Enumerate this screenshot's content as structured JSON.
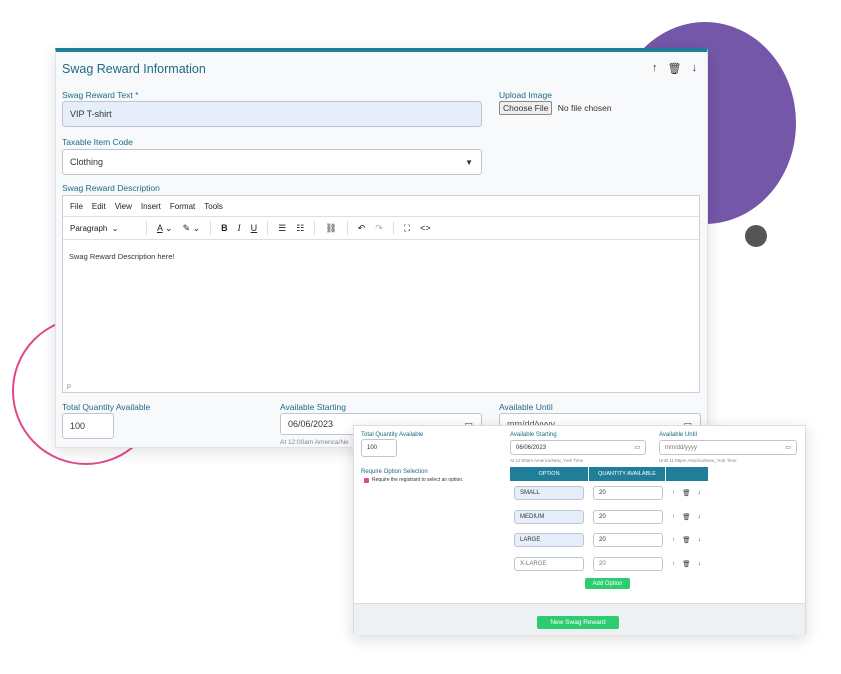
{
  "main": {
    "title": "Swag Reward Information",
    "header_icons": [
      "arrow-up-icon",
      "trash-icon",
      "arrow-down-icon"
    ],
    "reward_text_label": "Swag Reward Text *",
    "reward_text_value": "VIP T-shirt",
    "upload_label": "Upload Image",
    "choose_file": "Choose File",
    "no_file": "No file chosen",
    "taxable_label": "Taxable Item Code",
    "taxable_value": "Clothing",
    "desc_label": "Swag Reward Description",
    "menu": [
      "File",
      "Edit",
      "View",
      "Insert",
      "Format",
      "Tools"
    ],
    "paragraph": "Paragraph",
    "desc_body": "Swag Reward Description here!",
    "status_p": "P",
    "total_qty_label": "Total Quantity Available",
    "total_qty_value": "100",
    "avail_start_label": "Available Starting",
    "avail_start_value": "06/06/2023",
    "avail_start_note": "At 12:00am America/Ne",
    "avail_until_label": "Available Until",
    "avail_until_placeholder": "mm/dd/yyyy"
  },
  "popup": {
    "total_qty_label": "Total Quantity Available",
    "total_qty_value": "100",
    "avail_start_label": "Available Starting",
    "avail_start_value": "06/06/2023",
    "avail_start_note": "At 12:00am America/New_York Time",
    "avail_until_label": "Available Until",
    "avail_until_placeholder": "mm/dd/yyyy",
    "avail_until_note": "Until 11:59pm America/New_York Time",
    "require_label": "Require Option Selection",
    "require_text": "Require the registrant to select an option.",
    "col_option": "OPTION",
    "col_qty": "QUANTITY AVAILABLE",
    "options": [
      {
        "name": "SMALL",
        "qty": "20"
      },
      {
        "name": "MEDIUM",
        "qty": "20"
      },
      {
        "name": "LARGE",
        "qty": "20"
      },
      {
        "name": "X-LARGE",
        "qty": "20"
      }
    ],
    "add_option": "Add Option",
    "new_reward": "New Swag Reward"
  },
  "colors": {
    "accent": "#1f7f9b",
    "purple": "#7457a8",
    "pink": "#e0498c",
    "green": "#2ecc71"
  }
}
